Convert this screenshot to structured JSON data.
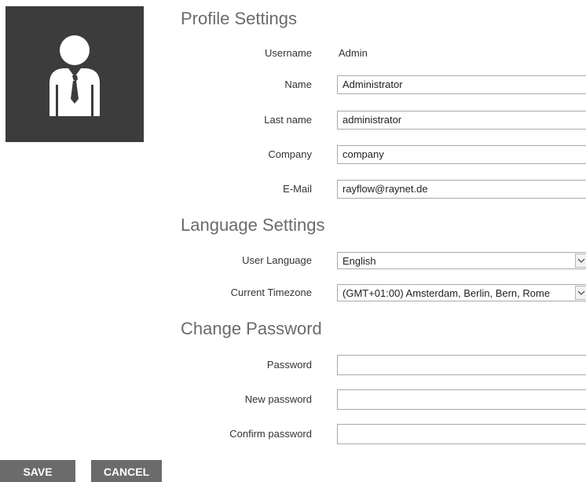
{
  "avatar": {
    "icon": "user-avatar-icon"
  },
  "profile": {
    "title": "Profile Settings",
    "username_label": "Username",
    "username_value": "Admin",
    "name_label": "Name",
    "name_value": "Administrator",
    "lastname_label": "Last name",
    "lastname_value": "administrator",
    "company_label": "Company",
    "company_value": "company",
    "email_label": "E-Mail",
    "email_value": "rayflow@raynet.de"
  },
  "language": {
    "title": "Language Settings",
    "user_language_label": "User Language",
    "user_language_value": "English",
    "timezone_label": "Current Timezone",
    "timezone_value": "(GMT+01:00) Amsterdam, Berlin, Bern, Rome"
  },
  "password": {
    "title": "Change Password",
    "password_label": "Password",
    "new_password_label": "New password",
    "confirm_password_label": "Confirm password"
  },
  "actions": {
    "save_label": "SAVE",
    "cancel_label": "CANCEL"
  },
  "colors": {
    "avatar_bg": "#3c3c3c",
    "button_bg": "#6b6b6b",
    "section_title": "#6b6b6b"
  }
}
